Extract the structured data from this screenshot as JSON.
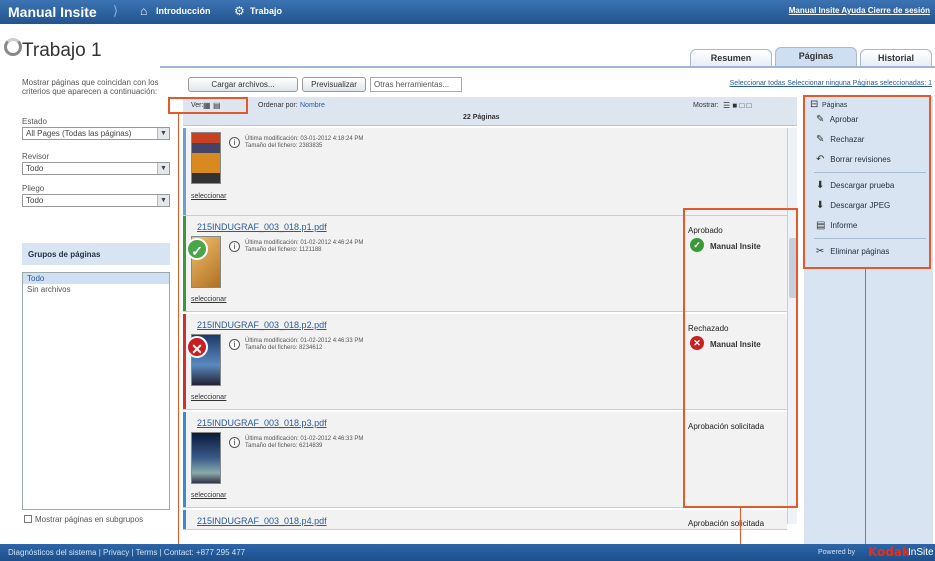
{
  "header": {
    "app_title": "Manual Insite",
    "nav": [
      {
        "icon": "home-icon",
        "label": "Introducción"
      },
      {
        "icon": "gear-icon",
        "label": "Trabajo"
      }
    ],
    "top_links": "Manual Insite  Ayuda  Cierre de sesión"
  },
  "job": {
    "title": "Trabajo 1"
  },
  "tabs": [
    {
      "label": "Resumen",
      "active": false
    },
    {
      "label": "Páginas",
      "active": true
    },
    {
      "label": "Historial",
      "active": false
    }
  ],
  "left_panel": {
    "intro": "Mostrar páginas que coincidan con los criterios que aparecen a continuación:",
    "estado_label": "Estado",
    "estado_value": "All Pages (Todas las páginas)",
    "revisor_label": "Revisor",
    "revisor_value": "Todo",
    "pliego_label": "Pliego",
    "pliego_value": "Todo",
    "groups_title": "Grupos de páginas",
    "groups": [
      "Todo",
      "Sin archivos"
    ],
    "show_in_subgroups": "Mostrar páginas en subgrupos"
  },
  "toolbar": {
    "upload": "Cargar archivos...",
    "preflight": "Previsualizar",
    "tools": "Otras herramientas...",
    "links": "Seleccionar todas  Seleccionar ninguna  Páginas seleccionadas: 1"
  },
  "list_header": {
    "view_label": "Ver:",
    "sort_label": "Ordenar por:",
    "sort_value": "Nombre",
    "count": "22 Páginas",
    "show_label": "Mostrar:"
  },
  "rows": [
    {
      "filename": "",
      "modified": "Última modificación: 03-01-2012 4:18:24 PM",
      "size": "Tamaño del fichero: 2383835",
      "select": "seleccionar",
      "status": "",
      "user": "",
      "bar_color": "#6aa0d8",
      "badge": ""
    },
    {
      "filename": "215INDUGRAF_003_018.p1.pdf",
      "modified": "Última modificación: 01-02-2012 4:46:24 PM",
      "size": "Tamaño del fichero: 1121188",
      "select": "seleccionar",
      "status": "Aprobado",
      "user": "Manual Insite",
      "bar_color": "#3a9a3a",
      "badge": "approved"
    },
    {
      "filename": "215INDUGRAF_003_018.p2.pdf",
      "modified": "Última modificación: 01-02-2012 4:46:33 PM",
      "size": "Tamaño del fichero: 8234612",
      "select": "seleccionar",
      "status": "Rechazado",
      "user": "Manual Insite",
      "bar_color": "#d03030",
      "badge": "rejected"
    },
    {
      "filename": "215INDUGRAF_003_018.p3.pdf",
      "modified": "Última modificación: 01-02-2012 4:46:33 PM",
      "size": "Tamaño del fichero: 6214839",
      "select": "seleccionar",
      "status": "Aprobación solicitada",
      "user": "",
      "bar_color": "#3a8ad8",
      "badge": ""
    },
    {
      "filename": "215INDUGRAF_003_018.p4.pdf",
      "modified": "",
      "size": "",
      "select": "",
      "status": "Aprobación solicitada",
      "user": "",
      "bar_color": "#3a8ad8",
      "badge": ""
    }
  ],
  "actions": {
    "title": "Páginas",
    "items": [
      {
        "icon": "approve-icon",
        "label": "Aprobar"
      },
      {
        "icon": "reject-icon",
        "label": "Rechazar"
      },
      {
        "icon": "delete-reviews-icon",
        "label": "Borrar revisiones"
      },
      {
        "icon": "download-proof-icon",
        "label": "Descargar prueba"
      },
      {
        "icon": "download-jpeg-icon",
        "label": "Descargar JPEG"
      },
      {
        "icon": "report-icon",
        "label": "Informe"
      },
      {
        "icon": "delete-pages-icon",
        "label": "Eliminar páginas"
      }
    ]
  },
  "footer": {
    "text": "Diagnósticos del sistema  |  Privacy  |  Terms  |  Contact: +877 295 477",
    "powered": "Powered by",
    "kodak": "Kodak",
    "insite": "InSite"
  },
  "colors": {
    "accent": "#2a5a9a",
    "callout": "#e05a2a"
  }
}
